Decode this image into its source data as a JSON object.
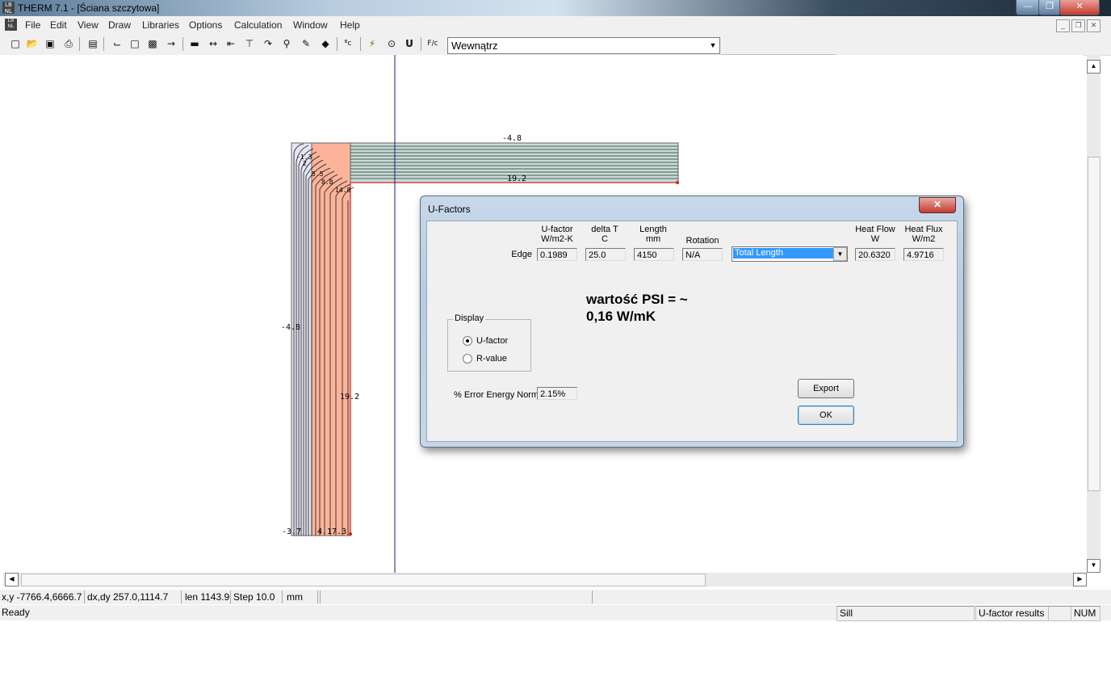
{
  "window": {
    "title": "THERM 7.1 - [Ściana szczytowa]"
  },
  "menu": [
    "File",
    "Edit",
    "View",
    "Draw",
    "Libraries",
    "Options",
    "Calculation",
    "Window",
    "Help"
  ],
  "toolbar": {
    "combo_value": "Wewnątrz"
  },
  "drawing": {
    "labels": {
      "top_temp": "-4.8",
      "top_inner": "19.2",
      "left_temp": "-4.8",
      "mid_temp": "19.2",
      "bottom_temp": "-3.7",
      "bottom_right": "4.17.3"
    },
    "colors": {
      "insulation": "#fbb49a",
      "wall": "#e5e5f4",
      "hatch": "#c6ddd8"
    }
  },
  "dialog": {
    "title": "U-Factors",
    "headers": {
      "ufactor": "U-factor",
      "ufactor_unit": "W/m2-K",
      "deltat": "delta T",
      "deltat_unit": "C",
      "length": "Length",
      "length_unit": "mm",
      "rotation": "Rotation",
      "heatflow": "Heat Flow",
      "heatflow_unit": "W",
      "heatflux": "Heat Flux",
      "heatflux_unit": "W/m2"
    },
    "row": {
      "label": "Edge",
      "ufactor": "0.1989",
      "deltat": "25.0",
      "length": "4150",
      "rotation": "N/A",
      "length_mode": "Total Length",
      "heatflow": "20.6320",
      "heatflux": "4.9716"
    },
    "annotation_line1": "wartość PSI = ~",
    "annotation_line2": "0,16 W/mK",
    "display": {
      "label": "Display",
      "opt1": "U-factor",
      "opt2": "R-value",
      "selected": "U-factor"
    },
    "error": {
      "label": "% Error Energy Norm",
      "value": "2.15%"
    },
    "export_label": "Export",
    "ok_label": "OK"
  },
  "status": {
    "xy": "x,y -7766.4,6666.7",
    "dxdy": "dx,dy 257.0,1114.7",
    "len": "len 1143.9",
    "step": "Step  10.0",
    "units": "mm",
    "ready": "Ready",
    "sill": "Sill",
    "results": "U-factor results",
    "num": "NUM"
  }
}
